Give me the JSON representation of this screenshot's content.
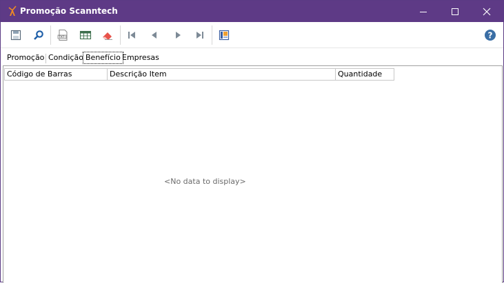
{
  "window": {
    "title": "Promoção Scanntech"
  },
  "toolbar": {
    "buttons": [
      {
        "name": "save",
        "icon": "save-icon"
      },
      {
        "name": "search",
        "icon": "search-icon"
      },
      {
        "name": "txt",
        "icon": "txt-file-icon",
        "label": "TXT"
      },
      {
        "name": "table",
        "icon": "table-icon"
      },
      {
        "name": "erase",
        "icon": "eraser-icon"
      },
      {
        "name": "first",
        "icon": "first-record-icon"
      },
      {
        "name": "prev",
        "icon": "previous-record-icon"
      },
      {
        "name": "next",
        "icon": "next-record-icon"
      },
      {
        "name": "last",
        "icon": "last-record-icon"
      },
      {
        "name": "report",
        "icon": "report-icon"
      },
      {
        "name": "help",
        "icon": "help-icon",
        "label": "?"
      }
    ]
  },
  "tabs": [
    {
      "label": "Promoção"
    },
    {
      "label": "Condição"
    },
    {
      "label": "Benefício"
    },
    {
      "label": "Empresas"
    }
  ],
  "active_tab": "Benefício",
  "grid": {
    "columns": [
      {
        "label": "Código de Barras"
      },
      {
        "label": "Descrição Item"
      },
      {
        "label": "Quantidade"
      }
    ],
    "empty_message": "<No data to display>"
  },
  "colors": {
    "titlebar": "#5e3a86",
    "help": "#3a6ea5"
  }
}
